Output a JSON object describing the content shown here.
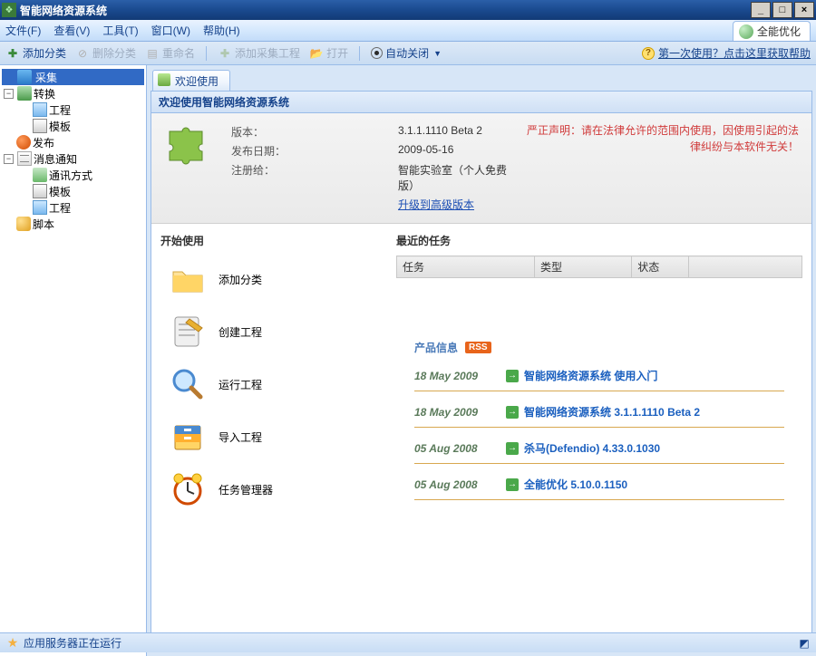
{
  "title": "智能网络资源系统",
  "menu": [
    "文件(F)",
    "查看(V)",
    "工具(T)",
    "窗口(W)",
    "帮助(H)"
  ],
  "optimize_badge": "全能优化",
  "toolbar": {
    "add_cat": "添加分类",
    "del_cat": "删除分类",
    "rename": "重命名",
    "add_proj": "添加采集工程",
    "open": "打开",
    "autoclose": "自动关闭",
    "help_link": "第一次使用？点击这里获取帮助"
  },
  "tree": {
    "collect": "采集",
    "convert": "转换",
    "project": "工程",
    "template": "模板",
    "publish": "发布",
    "message": "消息通知",
    "comm": "通讯方式",
    "script": "脚本"
  },
  "tab_label": "欢迎使用",
  "panel_title": "欢迎使用智能网络资源系统",
  "info": {
    "version_lbl": "版本：",
    "version_val": "3.1.1.1110 Beta 2",
    "date_lbl": "发布日期：",
    "date_val": "2009-05-16",
    "reg_lbl": "注册给：",
    "reg_val": "智能实验室（个人免费版）",
    "upgrade": "升级到高级版本",
    "disclaimer": "严正声明：请在法律允许的范围内使用，因使用引起的法律纠纷与本软件无关！"
  },
  "sections": {
    "start_title": "开始使用",
    "recent_title": "最近的任务",
    "actions": [
      "添加分类",
      "创建工程",
      "运行工程",
      "导入工程",
      "任务管理器"
    ]
  },
  "task_table": {
    "cols": [
      "任务",
      "类型",
      "状态",
      ""
    ]
  },
  "product_info": {
    "title": "产品信息",
    "rss": "RSS",
    "items": [
      {
        "date": "18 May 2009",
        "text": "智能网络资源系统 使用入门"
      },
      {
        "date": "18 May 2009",
        "text": "智能网络资源系统 3.1.1.1110 Beta 2"
      },
      {
        "date": "05 Aug 2008",
        "text": "杀马(Defendio) 4.33.0.1030"
      },
      {
        "date": "05 Aug 2008",
        "text": "全能优化 5.10.0.1150"
      }
    ]
  },
  "statusbar": "应用服务器正在运行"
}
